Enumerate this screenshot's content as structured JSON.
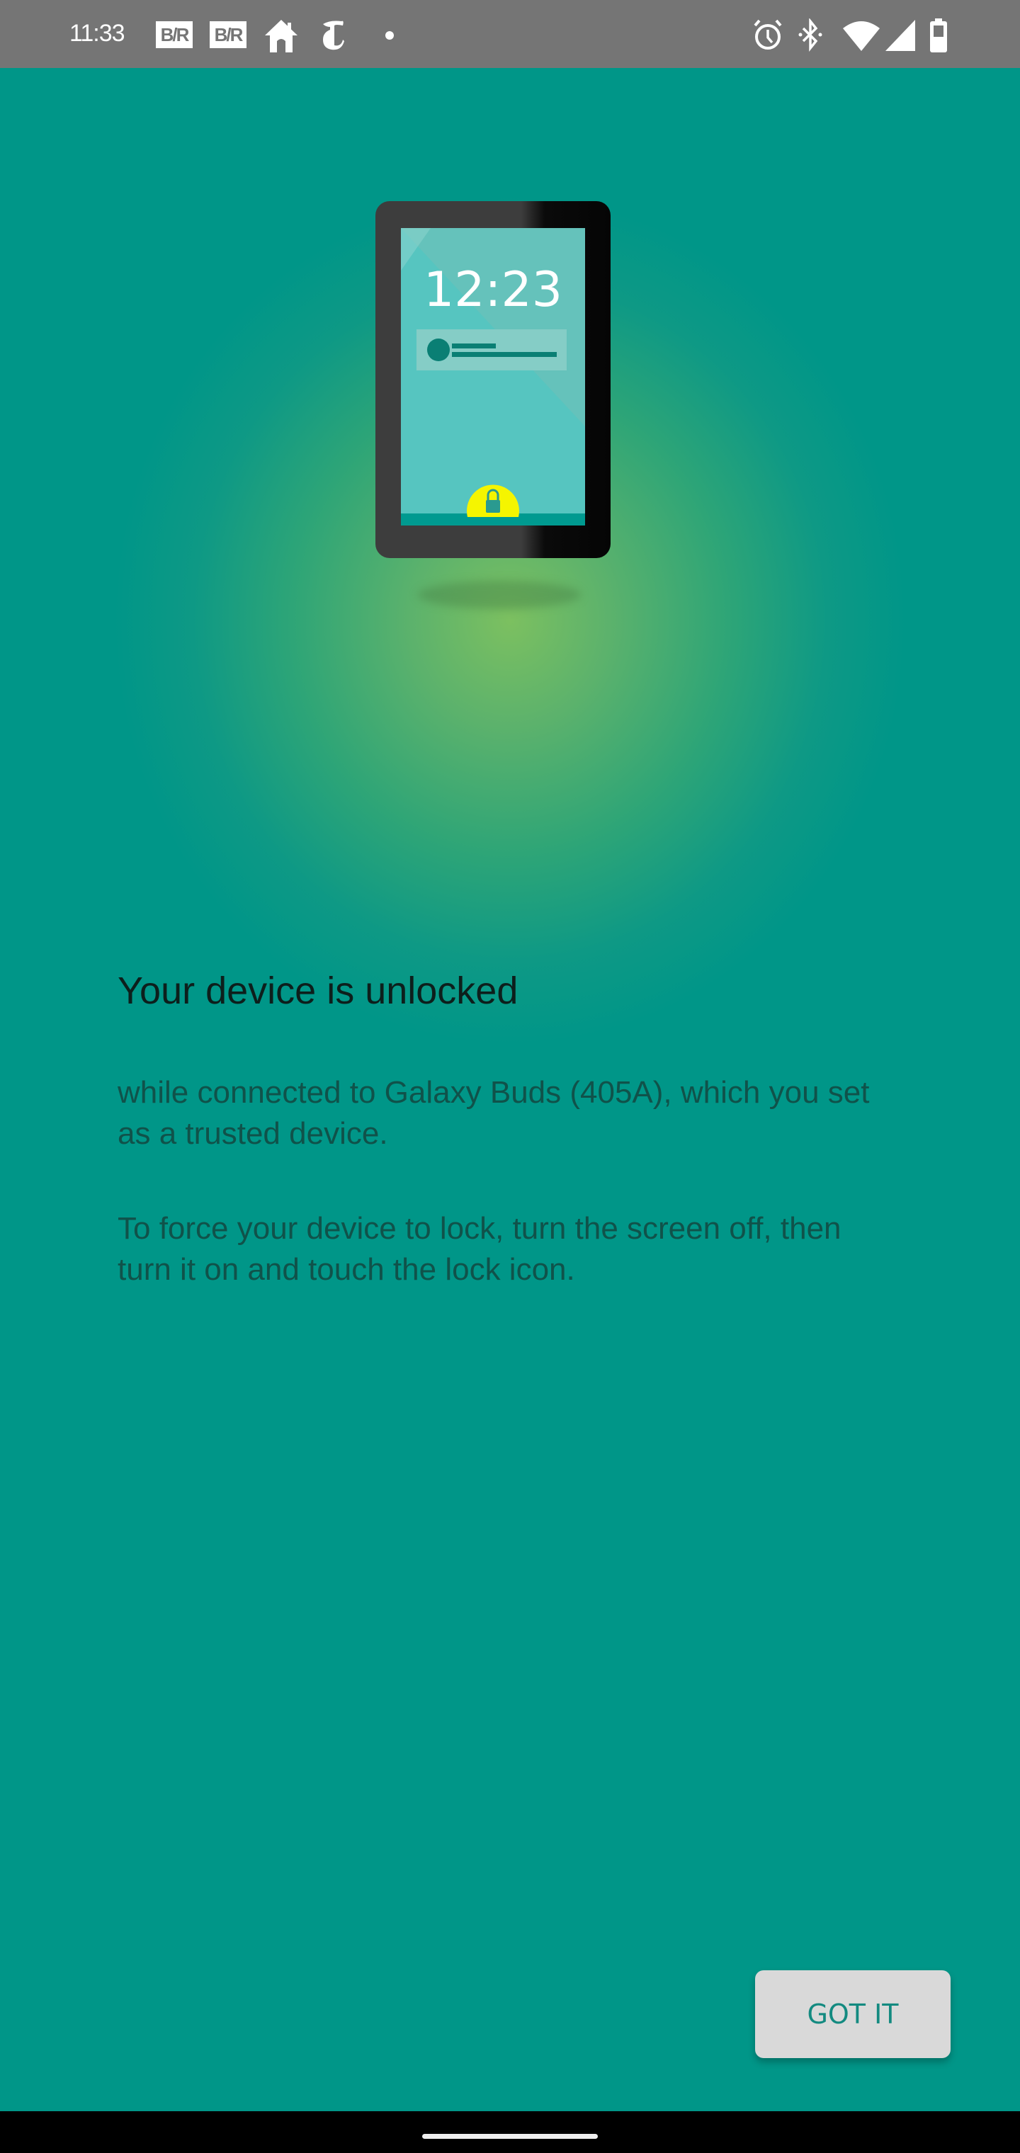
{
  "status_bar": {
    "time": "11:33",
    "notification_icons": [
      "bleacher-report-icon",
      "bleacher-report-icon",
      "home-icon",
      "nytimes-icon",
      "more-dot-icon"
    ],
    "br_label": "B/R",
    "system_icons": [
      "alarm-icon",
      "bluetooth-icon",
      "wifi-icon",
      "signal-icon",
      "battery-icon"
    ]
  },
  "illustration": {
    "clock_text": "12:23",
    "description": "phone-lock-screen-illustration"
  },
  "content": {
    "title": "Your device is unlocked",
    "paragraph_1": "while connected to Galaxy Buds (405A), which you set as a trusted device.",
    "paragraph_2": "To force your device to lock, turn the screen off, then turn it on and touch the lock icon."
  },
  "actions": {
    "got_it_label": "GOT IT"
  },
  "colors": {
    "background": "#009688",
    "button_background": "#d9d9d9",
    "button_text": "#138a80",
    "status_bar": "#757575",
    "lock_badge": "#f5f500"
  }
}
